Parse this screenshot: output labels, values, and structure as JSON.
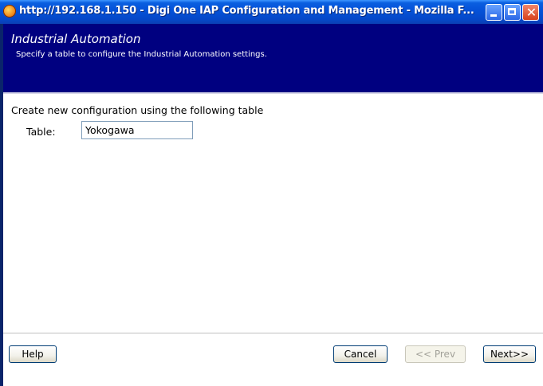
{
  "window": {
    "title": "http://192.168.1.150 - Digi One IAP Configuration and Management - Mozilla F...",
    "controls": {
      "minimize": "",
      "maximize": "",
      "close": "✕"
    }
  },
  "header": {
    "title": "Industrial Automation",
    "subtitle": "Specify a table to configure the Industrial Automation settings."
  },
  "content": {
    "intro": "Create new configuration using the following table",
    "table_label": "Table:",
    "table_value": "Yokogawa"
  },
  "buttons": {
    "help": "Help",
    "cancel": "Cancel",
    "prev": "<< Prev",
    "next": "Next>>"
  }
}
